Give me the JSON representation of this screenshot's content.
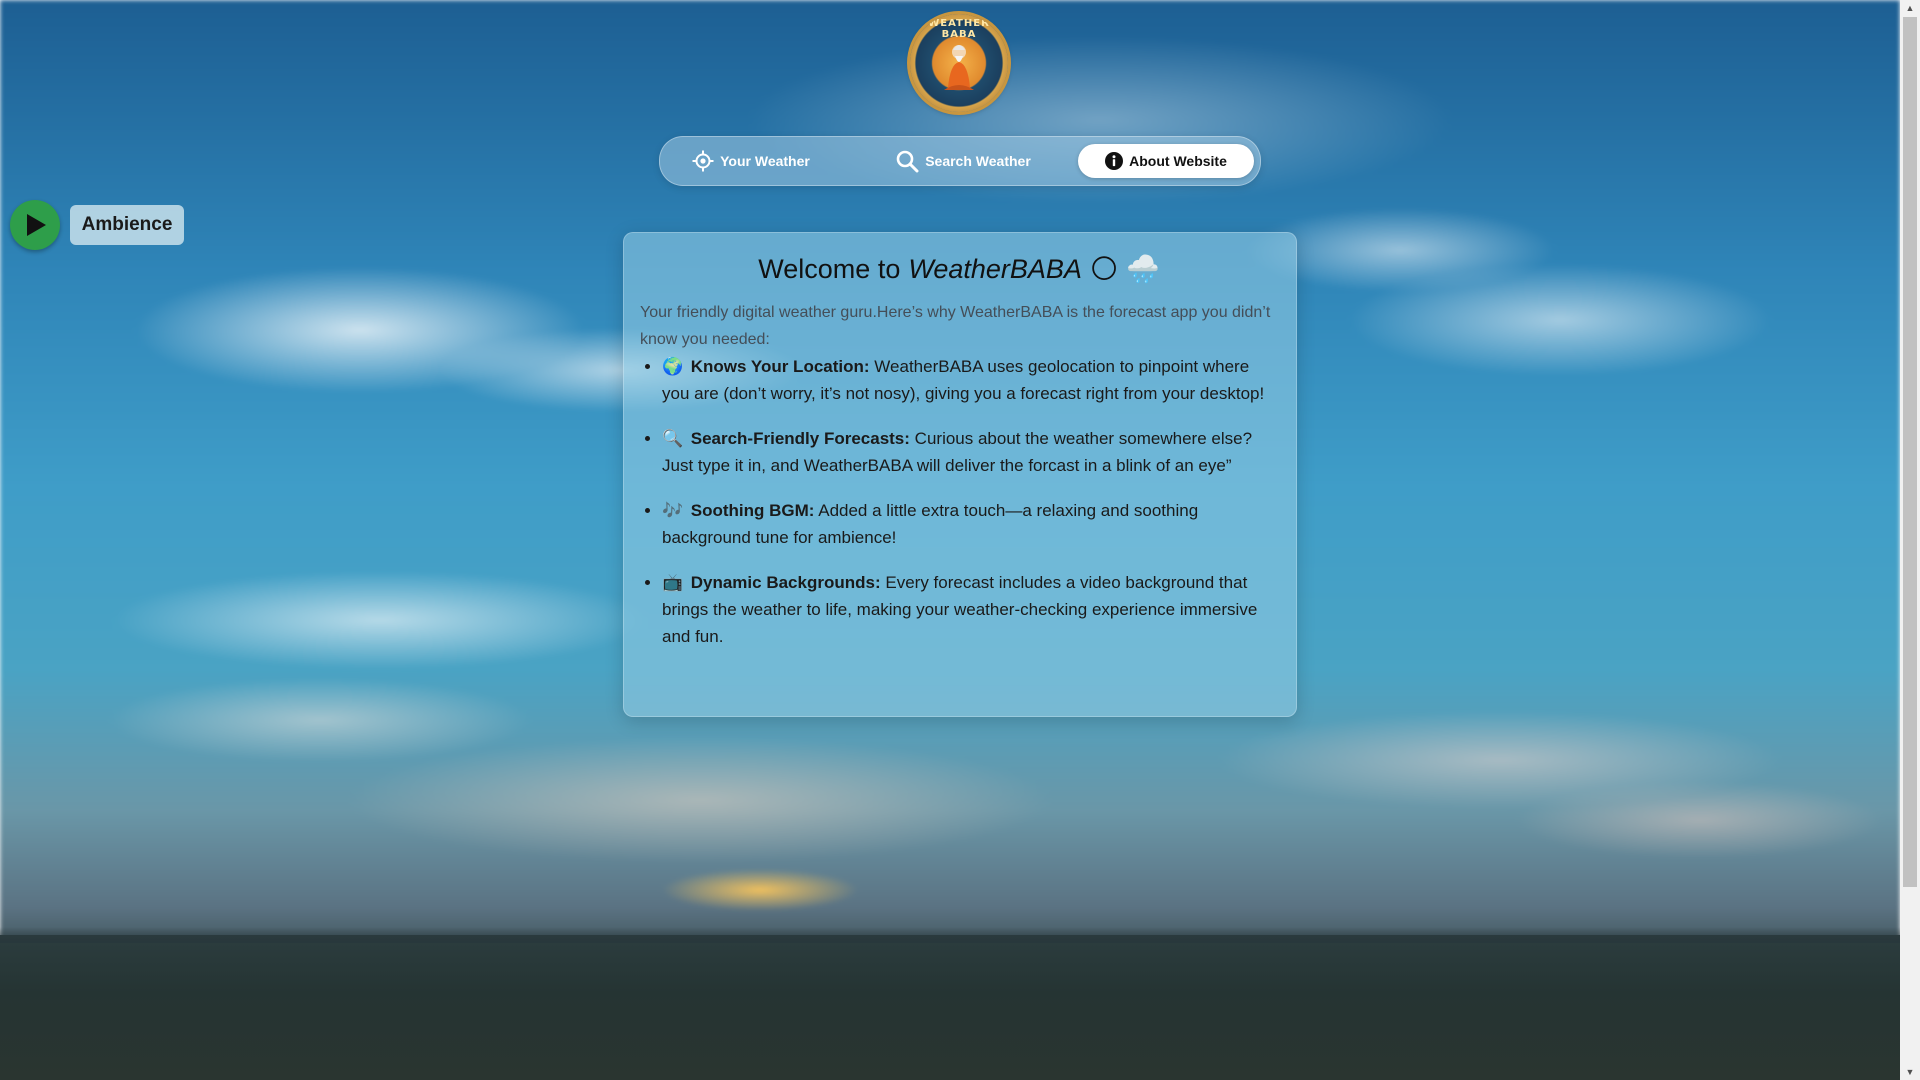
{
  "logo": {
    "text": "WEATHER BABA"
  },
  "nav": {
    "items": [
      {
        "label": "Your Weather",
        "icon": "crosshair-icon"
      },
      {
        "label": "Search Weather",
        "icon": "search-icon"
      },
      {
        "label": "About Website",
        "icon": "info-icon",
        "active": true
      }
    ]
  },
  "ambience": {
    "label": "Ambience",
    "icon": "play-icon",
    "color": "#2e9e4a"
  },
  "card": {
    "title_prefix": "Welcome to",
    "title_brand": "WeatherBABA",
    "title_emojis": [
      "🌕",
      "🌧️"
    ],
    "intro": "Your friendly digital weather guru.Here’s why WeatherBABA is the forecast app you didn’t know you needed:",
    "features": [
      {
        "emoji": "🌍",
        "title": "Knows Your Location:",
        "text": "WeatherBABA uses geolocation to pinpoint where you are (don’t worry, it’s not nosy), giving you a forecast right from your desktop!"
      },
      {
        "emoji": "🔍",
        "title": "Search-Friendly Forecasts:",
        "text": "Curious about the weather somewhere else? Just type it in, and WeatherBABA will deliver the forcast in a blink of an eye”"
      },
      {
        "emoji": "🎶",
        "title": "Soothing BGM:",
        "text": "Added a little extra touch—a relaxing and soothing background tune for ambience!"
      },
      {
        "emoji": "📺",
        "title": "Dynamic Backgrounds:",
        "text": "Every forecast includes a video background that brings the weather to life, making your weather-checking experience immersive and fun."
      }
    ]
  },
  "scrollbar": {
    "up_arrow": "▲",
    "down_arrow": "▼"
  }
}
